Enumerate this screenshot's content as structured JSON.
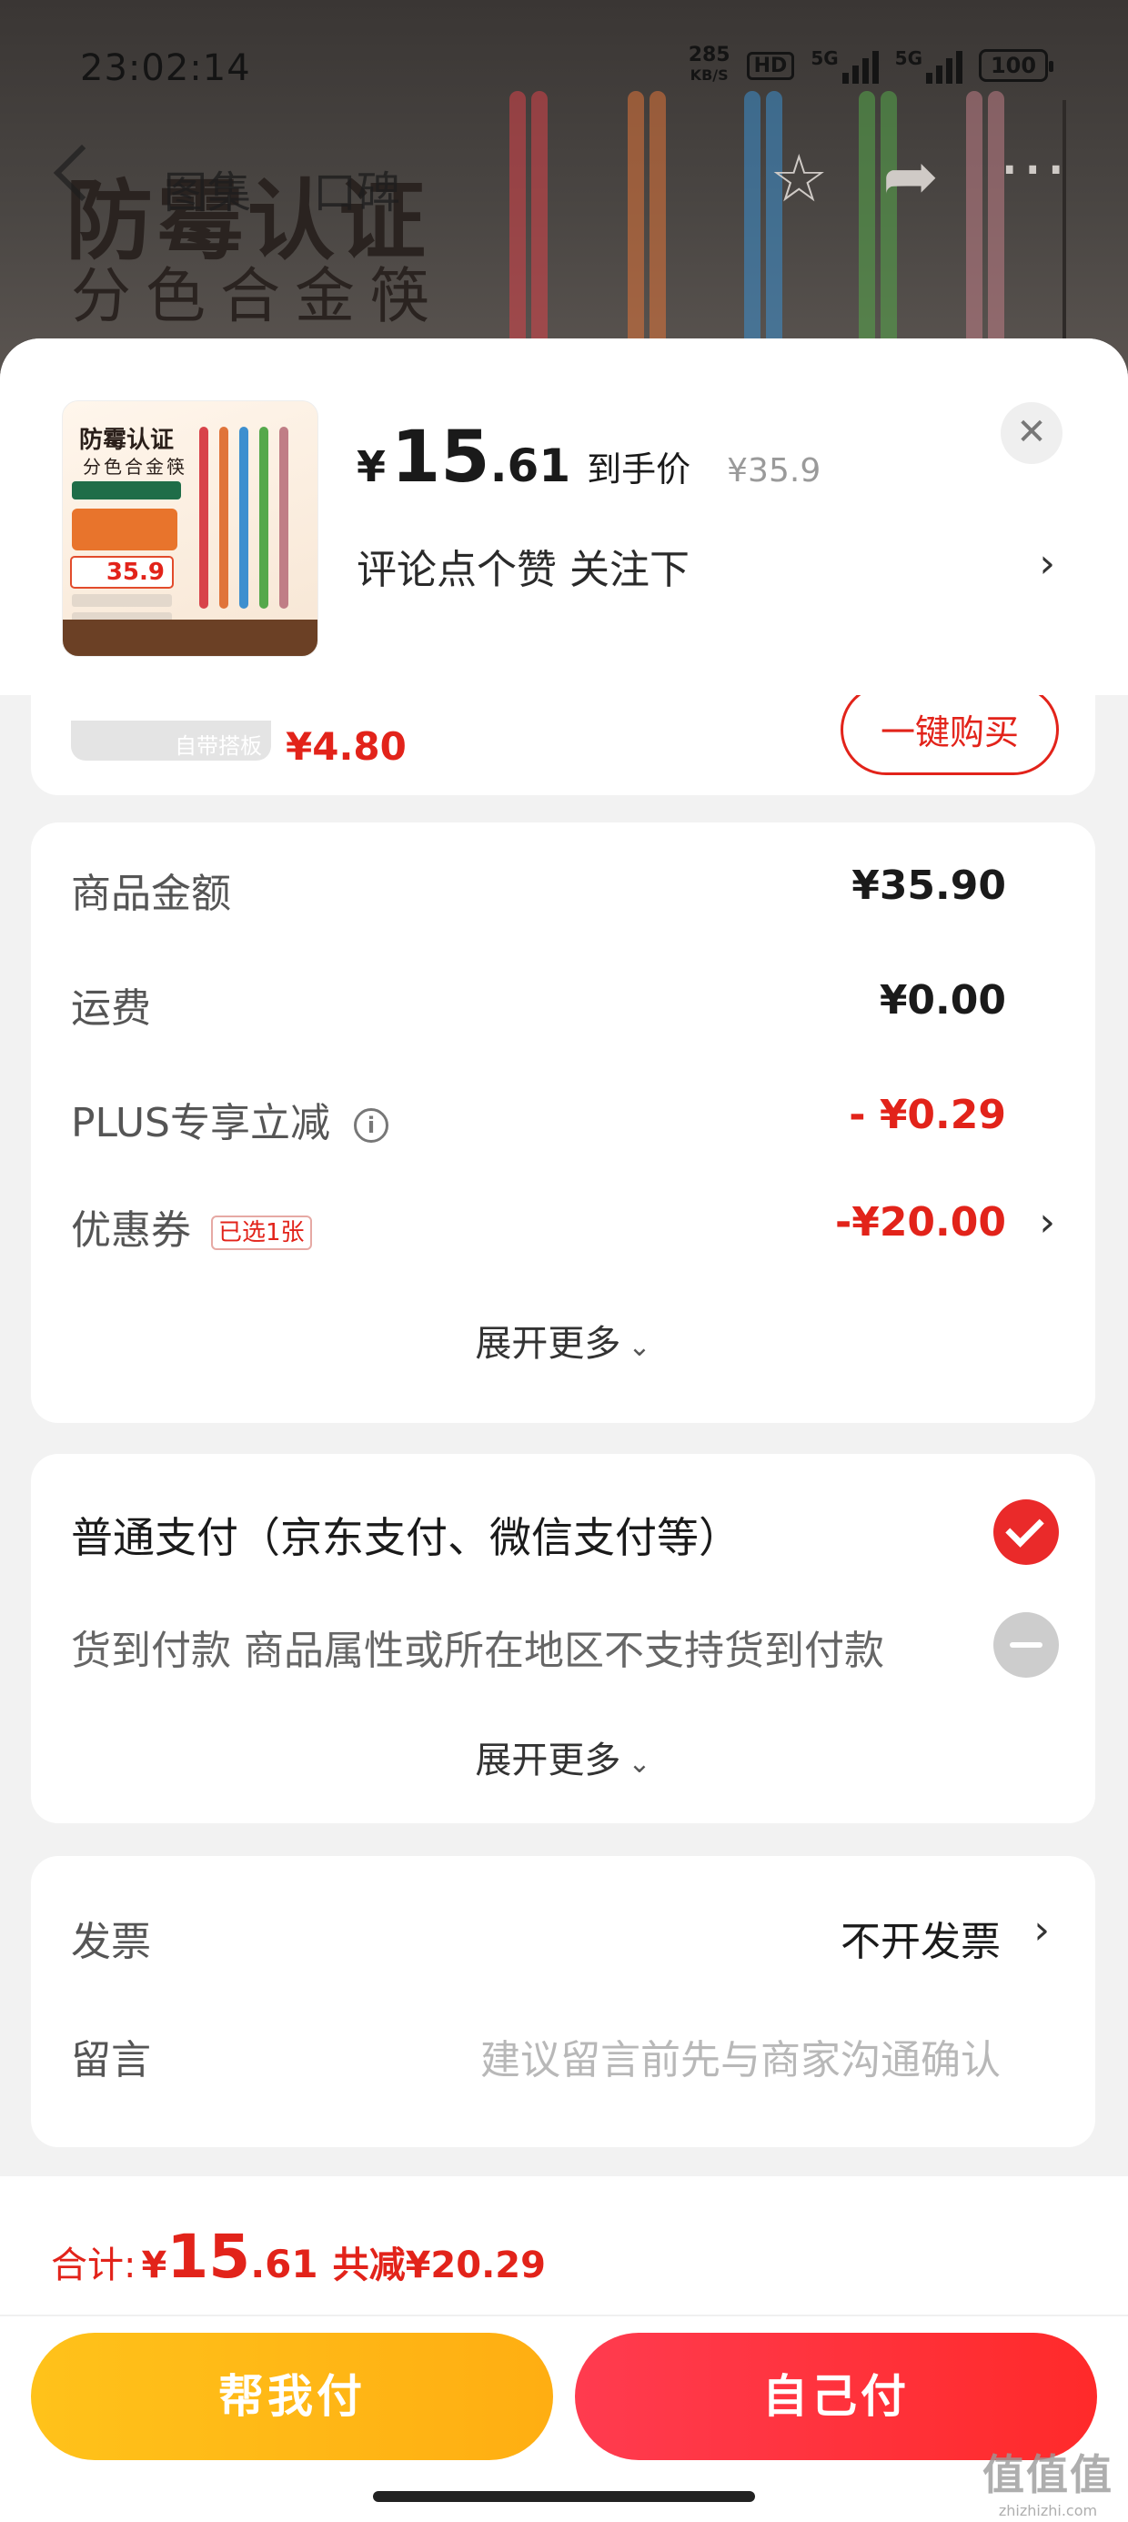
{
  "status_bar": {
    "time": "23:02:14",
    "speed_value": "285",
    "speed_unit": "KB/S",
    "hd": "HD",
    "signal1": "5G",
    "signal2": "5G",
    "battery": "100"
  },
  "background": {
    "nav_tab_gallery": "图集",
    "nav_tab_reviews": "口碑",
    "banner_title": "防霉认证",
    "banner_subtitle": "分色合金筷"
  },
  "sheet_header": {
    "thumbnail_title": "防霉认证",
    "thumbnail_subtitle": "分色合金筷",
    "thumbnail_price": "35.9",
    "currency": "¥",
    "price_int": "15",
    "price_dec": ".61",
    "price_tag": "到手价",
    "original_price": "¥35.9",
    "product_name": "评论点个赞 关注下",
    "close_symbol": "✕",
    "chevron": "›"
  },
  "cut_card": {
    "thumb_label": "自带搭板",
    "price": "¥4.80",
    "button_label": "一键购买"
  },
  "summary": {
    "rows": [
      {
        "label": "商品金额",
        "value": "¥35.90"
      },
      {
        "label": "运费",
        "value": "¥0.00"
      },
      {
        "label": "PLUS专享立减",
        "value": "- ¥0.29"
      },
      {
        "label": "优惠券",
        "value": "-¥20.00"
      }
    ],
    "info_symbol": "i",
    "coupon_tag": "已选1张",
    "chevron": "›",
    "expand_label": "展开更多",
    "expand_icon": "⌄"
  },
  "payment": {
    "normal_label": "普通支付（京东支付、微信支付等）",
    "cod_label": "货到付款 商品属性或所在地区不支持货到付款",
    "expand_label": "展开更多",
    "expand_icon": "⌄"
  },
  "invoice": {
    "invoice_label": "发票",
    "invoice_value": "不开发票",
    "chevron": "›",
    "message_label": "留言",
    "message_placeholder": "建议留言前先与商家沟通确认"
  },
  "bottom_bar": {
    "total_label": "合计:",
    "total_currency": "¥",
    "total_int": "15",
    "total_dec": ".61",
    "total_saving": "共减¥20.29",
    "help_pay_label": "帮我付",
    "self_pay_label": "自己付",
    "watermark_main": "值值值",
    "watermark_sub": "zhizhizhi.com"
  },
  "colors": {
    "accent_red": "#e2231a",
    "help_button": "#ffb815",
    "self_button": "#ff2f3f"
  }
}
